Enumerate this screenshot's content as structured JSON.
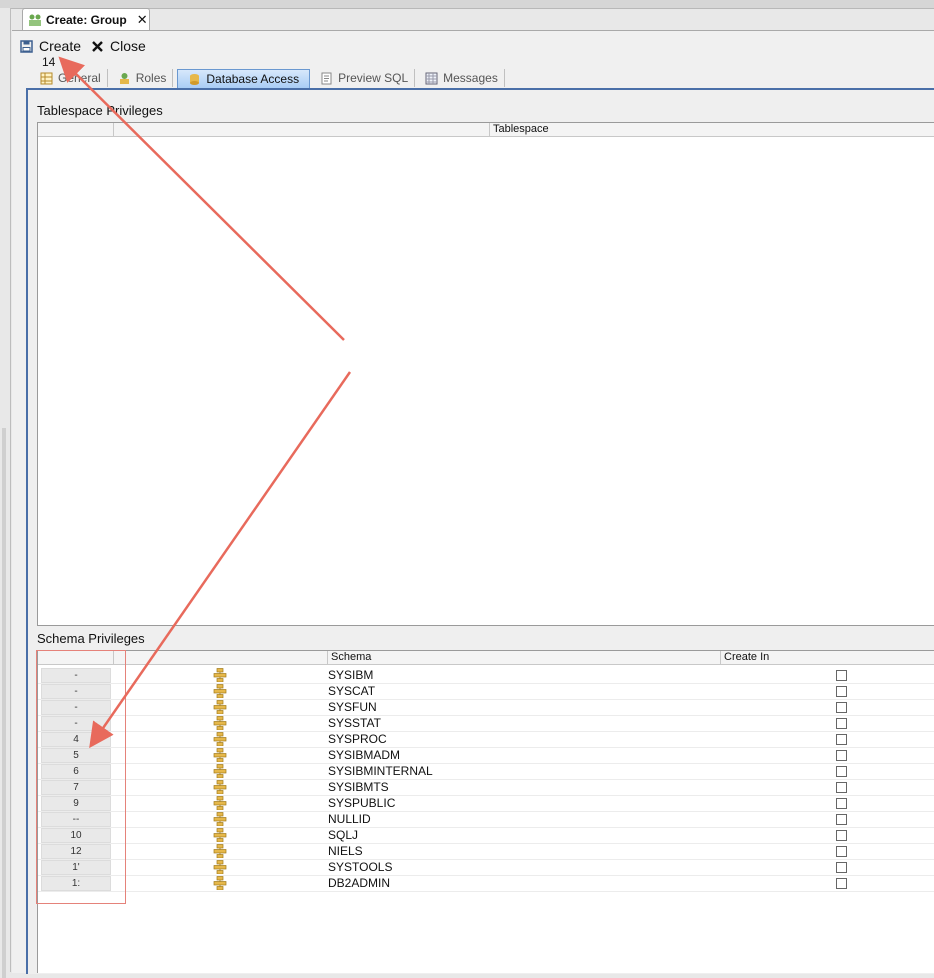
{
  "editor_tab": {
    "title": "Create: Group"
  },
  "toolbar": {
    "create_label": "Create",
    "close_label": "Close"
  },
  "counter": "14",
  "subtabs": [
    {
      "label": "General"
    },
    {
      "label": "Roles"
    },
    {
      "label": "Database Access"
    },
    {
      "label": "Preview SQL"
    },
    {
      "label": "Messages"
    }
  ],
  "tablespace": {
    "title": "Tablespace Privileges",
    "column_header": "Tablespace"
  },
  "schema": {
    "title": "Schema Privileges",
    "headers": {
      "schema": "Schema",
      "create_in": "Create In"
    },
    "rows": [
      {
        "num": "-",
        "name": "SYSIBM"
      },
      {
        "num": "-",
        "name": "SYSCAT"
      },
      {
        "num": "-",
        "name": "SYSFUN"
      },
      {
        "num": "-",
        "name": "SYSSTAT"
      },
      {
        "num": "4",
        "name": "SYSPROC"
      },
      {
        "num": "5",
        "name": "SYSIBMADM"
      },
      {
        "num": "6",
        "name": "SYSIBMINTERNAL"
      },
      {
        "num": "7",
        "name": "SYSIBMTS"
      },
      {
        "num": "9",
        "name": "SYSPUBLIC"
      },
      {
        "num": "--",
        "name": "NULLID"
      },
      {
        "num": "10",
        "name": "SQLJ"
      },
      {
        "num": "12",
        "name": "NIELS"
      },
      {
        "num": "1'",
        "name": "SYSTOOLS"
      },
      {
        "num": "1:",
        "name": "DB2ADMIN"
      }
    ]
  },
  "colors": {
    "accent_border": "#4a6fa8",
    "active_tab": "#a9cdf5",
    "annotation": "#e86a5c"
  },
  "icons": [
    "group-icon",
    "save-icon",
    "close-x-icon",
    "grid-icon",
    "roles-icon",
    "database-icon",
    "sql-icon",
    "messages-icon",
    "schema-icon"
  ]
}
